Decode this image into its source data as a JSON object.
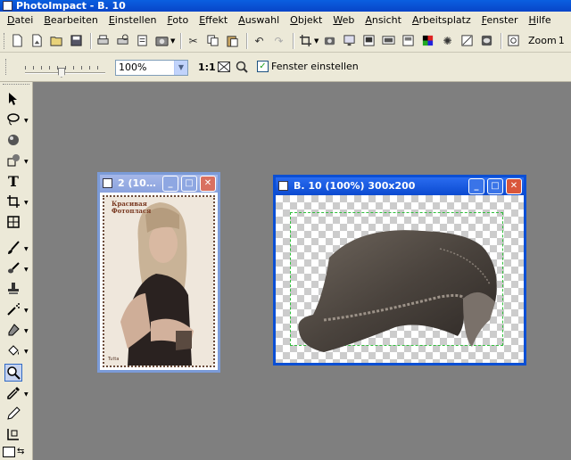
{
  "app": {
    "title": "PhotoImpact - B. 10"
  },
  "menu": [
    "Datei",
    "Bearbeiten",
    "Einstellen",
    "Foto",
    "Effekt",
    "Auswahl",
    "Objekt",
    "Web",
    "Ansicht",
    "Arbeitsplatz",
    "Fenster",
    "Hilfe"
  ],
  "toolbar": {
    "zoom_label": "Zoom",
    "zoom_value": "1"
  },
  "attributes": {
    "zoom_select": "100%",
    "one_to_one": "1:1",
    "fit_window_label": "Fenster einstellen",
    "fit_window_checked": true,
    "slider_level": 0.45
  },
  "documents": [
    {
      "title": "2 (10…"
    },
    {
      "title": "B. 10 (100%) 300x200"
    }
  ],
  "photo_text": {
    "line1": "Красивая",
    "line2": "Фотоплася",
    "signature": "Tutta"
  },
  "colors": {
    "title_blue": "#0b4fd4",
    "inactive_blue": "#7b9bd8",
    "workspace": "#7f7f7f",
    "marquee": "#2fbf3a"
  }
}
